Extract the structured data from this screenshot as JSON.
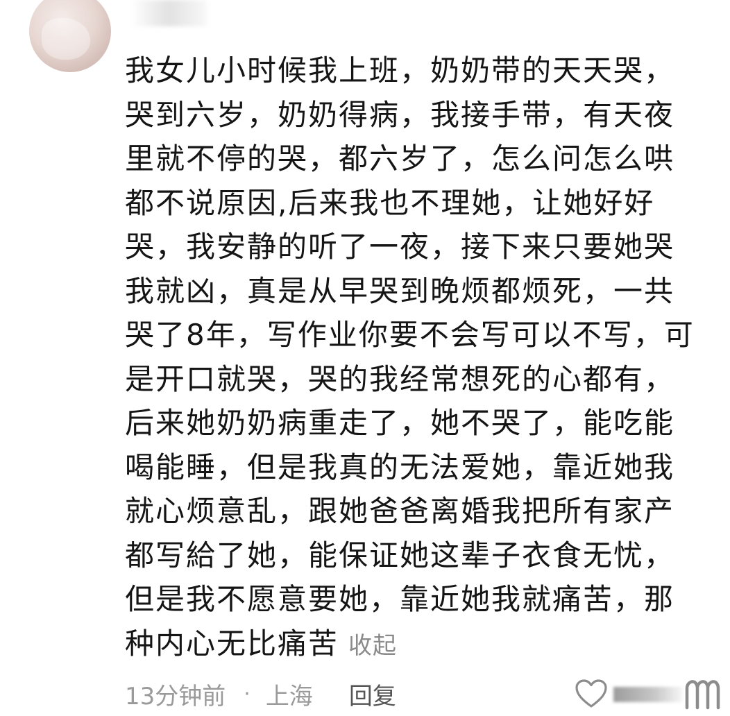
{
  "comment": {
    "lines": [
      "我女儿小时候我上班，奶奶带的天天哭，",
      "哭到六岁，奶奶得病，我接手带，有天夜",
      "里就不停的哭，都六岁了，怎么问怎么哄",
      "都不说原因,后来我也不理她，让她好好",
      "哭，我安静的听了一夜，接下来只要她哭",
      "我就凶，真是从早哭到晚烦都烦死，一共",
      "哭了8年，写作业你要不会写可以不写，可",
      "是开口就哭，哭的我经常想死的心都有，",
      "后来她奶奶病重走了，她不哭了，能吃能",
      "喝能睡，但是我真的无法爱她，靠近她我",
      "就心烦意乱，跟她爸爸离婚我把所有家产",
      "都写給了她，能保证她这辈子衣食无忧，",
      "但是我不愿意要她，靠近她我就痛苦，那",
      "种内心无比痛苦"
    ],
    "collapse_label": "收起"
  },
  "meta": {
    "time": "13分钟前",
    "separator": "·",
    "location": "上海",
    "reply_label": "回复"
  },
  "icons": {
    "like": "heart-outline-icon",
    "more": "more-icon"
  },
  "colors": {
    "text": "#151515",
    "secondary": "#9a9a9a",
    "reply": "#555555"
  }
}
